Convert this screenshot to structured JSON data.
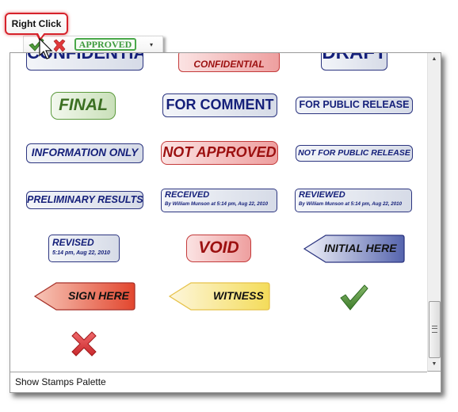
{
  "callout": {
    "label": "Right Click"
  },
  "toolbar": {
    "check_icon": "check-icon",
    "x_icon": "x-icon",
    "approved_label": "APPROVED",
    "dropdown_glyph": "▾"
  },
  "palette": {
    "stamps": [
      {
        "label": "CONFIDENTIAL",
        "style": "blue",
        "partial": true
      },
      {
        "label": "CONFIDENTIAL",
        "style": "red"
      },
      {
        "label": "DRAFT",
        "style": "blue",
        "partial": true
      },
      {
        "label": "FINAL",
        "style": "green"
      },
      {
        "label": "FOR COMMENT",
        "style": "blue"
      },
      {
        "label": "FOR PUBLIC RELEASE",
        "style": "blue"
      },
      {
        "label": "INFORMATION ONLY",
        "style": "blue"
      },
      {
        "label": "NOT APPROVED",
        "style": "red"
      },
      {
        "label": "NOT FOR PUBLIC RELEASE",
        "style": "blue"
      },
      {
        "label": "PRELIMINARY RESULTS",
        "style": "blue"
      },
      {
        "label": "RECEIVED",
        "sub": "By William Munson at 5:14 pm, Aug 22, 2010",
        "style": "blue"
      },
      {
        "label": "REVIEWED",
        "sub": "By William Munson at 5:14 pm, Aug 22, 2010",
        "style": "blue"
      },
      {
        "label": "REVISED",
        "sub": "5:14 pm, Aug 22, 2010",
        "style": "blue"
      },
      {
        "label": "VOID",
        "style": "red"
      },
      {
        "label": "INITIAL HERE",
        "style": "blue-arrow"
      },
      {
        "label": "SIGN HERE",
        "style": "red-arrow"
      },
      {
        "label": "WITNESS",
        "style": "yellow-arrow"
      },
      {
        "label": "check-icon",
        "style": "icon"
      },
      {
        "label": "x-icon",
        "style": "icon"
      }
    ]
  },
  "scrollbar": {
    "up_glyph": "▲",
    "down_glyph": "▼"
  },
  "footer": {
    "label": "Show Stamps Palette"
  },
  "colors": {
    "blue_text": "#15207a",
    "red_text": "#9c1010",
    "green_text": "#3b6f21",
    "callout_border": "#d6222b",
    "approved_green": "#4aa84a"
  }
}
